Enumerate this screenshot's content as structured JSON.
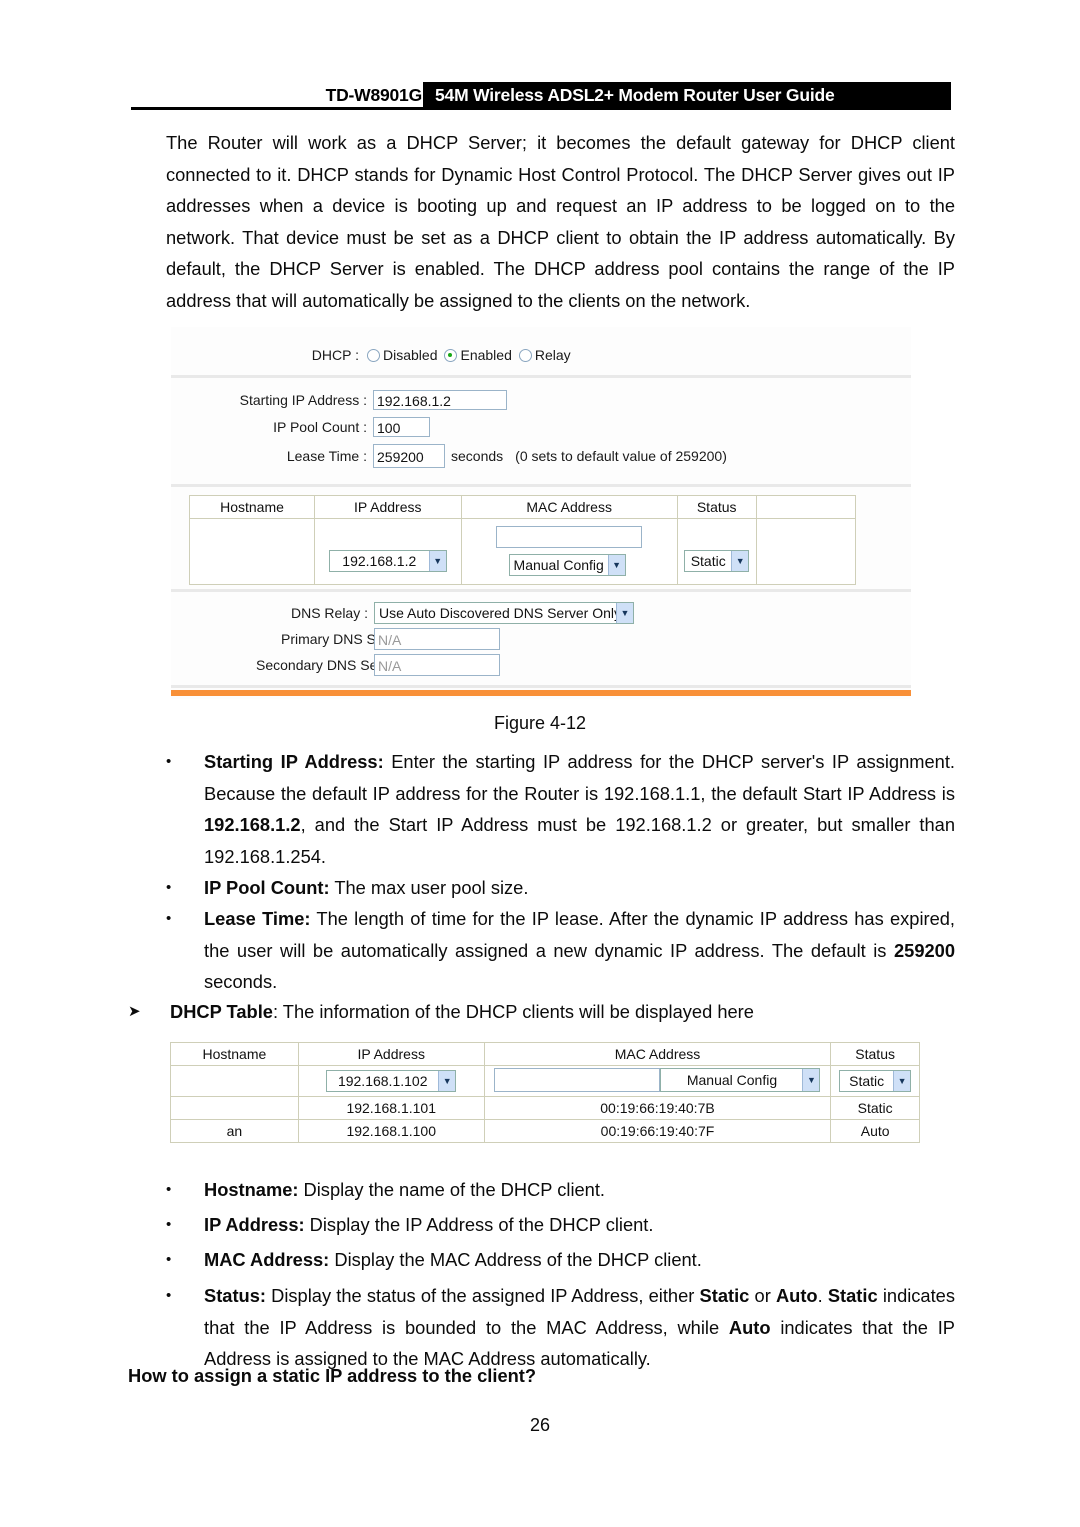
{
  "header": {
    "model": "TD-W8901G",
    "title": "54M Wireless ADSL2+ Modem Router User Guide"
  },
  "intro_paragraph": "The Router will work as a DHCP Server; it becomes the default gateway for DHCP client connected to it. DHCP stands for Dynamic Host Control Protocol. The DHCP Server gives out IP addresses when a device is booting up and request an IP address to be logged on to the network. That device must be set as a DHCP client to obtain the IP address automatically. By default, the DHCP Server is enabled. The DHCP address pool contains the range of the IP address that will automatically be assigned to the clients on the network.",
  "figure": {
    "caption": "Figure 4-12",
    "accent_color": "#F89038",
    "dhcp": {
      "label": "DHCP :",
      "options": [
        "Disabled",
        "Enabled",
        "Relay"
      ],
      "selected": "Enabled"
    },
    "fields": {
      "starting_ip_label": "Starting IP Address :",
      "starting_ip_value": "192.168.1.2",
      "pool_count_label": "IP Pool Count :",
      "pool_count_value": "100",
      "lease_time_label": "Lease Time :",
      "lease_time_value": "259200",
      "lease_time_unit": "seconds",
      "lease_time_hint": "(0 sets to default value of 259200)"
    },
    "table": {
      "headers": [
        "Hostname",
        "IP Address",
        "MAC Address",
        "Status"
      ],
      "row": {
        "hostname": "",
        "ip_select_value": "192.168.1.2",
        "mac_input_value": "",
        "mac_select_value": "Manual Config",
        "status_select_value": "Static"
      }
    },
    "dns": {
      "relay_label": "DNS Relay :",
      "relay_value": "Use Auto Discovered DNS Server Only",
      "primary_label": "Primary DNS Server :",
      "primary_value": "N/A",
      "secondary_label": "Secondary DNS Server :",
      "secondary_value": "N/A"
    }
  },
  "bullets": {
    "starting_ip": {
      "term": "Starting IP Address:",
      "text": " Enter the starting IP address for the DHCP server's IP assignment. Because the default IP address for the Router is 192.168.1.1, the default Start IP Address is ",
      "bold_value": "192.168.1.2",
      "text2": ", and the Start IP Address must be 192.168.1.2 or greater, but smaller than 192.168.1.254."
    },
    "pool_count": {
      "term": "IP Pool Count:",
      "text": " The max user pool size."
    },
    "lease_time": {
      "term": "Lease Time:",
      "text": " The length of time for the IP lease. After the dynamic IP address has expired, the user will be automatically assigned a new dynamic IP address. The default is ",
      "bold_value": "259200",
      "text2": " seconds."
    },
    "dhcp_table": {
      "term": "DHCP Table",
      "text": ": The information of the DHCP clients will be displayed here"
    },
    "hostname": {
      "term": "Hostname:",
      "text": " Display the name of the DHCP client."
    },
    "ip_address": {
      "term": "IP Address:",
      "text": " Display the IP Address of the DHCP client."
    },
    "mac_address": {
      "term": "MAC Address:",
      "text": " Display the MAC Address of the DHCP client."
    },
    "status": {
      "term": "Status:",
      "t1": " Display the status of the assigned IP Address, either ",
      "b1": "Static",
      "t2": " or ",
      "b2": "Auto",
      "t3": ". ",
      "b3": "Static",
      "t4": " indicates that the IP Address is bounded to the MAC Address, while ",
      "b4": "Auto",
      "t5": " indicates that the IP Address is assigned to the MAC Address automatically."
    }
  },
  "dhcp_table_figure": {
    "headers": [
      "Hostname",
      "IP Address",
      "MAC Address",
      "Status"
    ],
    "rows": [
      {
        "type": "editable",
        "hostname": "",
        "ip_select_value": "192.168.1.102",
        "mac_input_value": "",
        "mac_select_value": "Manual Config",
        "status_select_value": "Static"
      },
      {
        "type": "static",
        "hostname": "",
        "ip": "192.168.1.101",
        "mac": "00:19:66:19:40:7B",
        "status": "Static"
      },
      {
        "type": "static",
        "hostname": "an",
        "ip": "192.168.1.100",
        "mac": "00:19:66:19:40:7F",
        "status": "Auto"
      }
    ]
  },
  "howto_heading": "How to assign a static IP address to the client?",
  "page_number": "26"
}
